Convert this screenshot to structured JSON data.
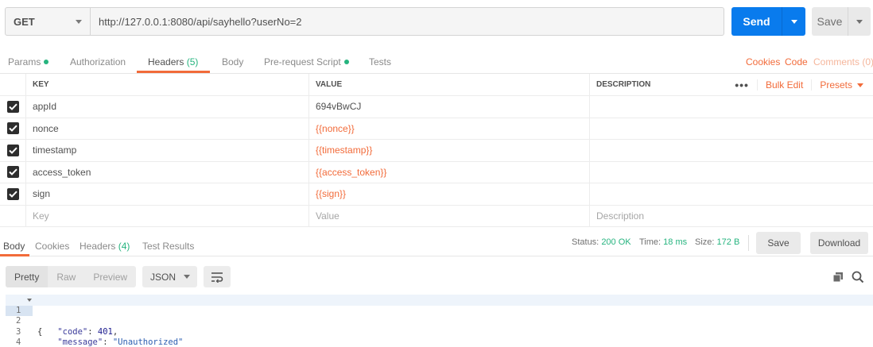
{
  "request": {
    "method": "GET",
    "url": "http://127.0.0.1:8080/api/sayhello?userNo=2",
    "send_label": "Send",
    "save_label": "Save"
  },
  "request_tabs": {
    "params": "Params",
    "authorization": "Authorization",
    "headers": "Headers",
    "headers_count": "(5)",
    "body": "Body",
    "prerequest": "Pre-request Script",
    "tests": "Tests",
    "cookies": "Cookies",
    "code": "Code",
    "comments": "Comments (0)"
  },
  "headers_table": {
    "columns": {
      "key": "KEY",
      "value": "VALUE",
      "description": "DESCRIPTION"
    },
    "more": "•••",
    "bulk_edit": "Bulk Edit",
    "presets": "Presets",
    "rows": [
      {
        "key": "appId",
        "value": "694vBwCJ",
        "checked": true
      },
      {
        "key": "nonce",
        "value": "{{nonce}}",
        "checked": true
      },
      {
        "key": "timestamp",
        "value": "{{timestamp}}",
        "checked": true
      },
      {
        "key": "access_token",
        "value": "{{access_token}}",
        "checked": true
      },
      {
        "key": "sign",
        "value": "{{sign}}",
        "checked": true
      }
    ],
    "placeholder": {
      "key": "Key",
      "value": "Value",
      "description": "Description"
    }
  },
  "response_tabs": {
    "body": "Body",
    "cookies": "Cookies",
    "headers": "Headers",
    "headers_count": "(4)",
    "test_results": "Test Results"
  },
  "response_meta": {
    "status_label": "Status:",
    "status_value": "200 OK",
    "time_label": "Time:",
    "time_value": "18 ms",
    "size_label": "Size:",
    "size_value": "172 B",
    "save": "Save",
    "download": "Download"
  },
  "response_toolbar": {
    "pretty": "Pretty",
    "raw": "Raw",
    "preview": "Preview",
    "format": "JSON"
  },
  "response_body": {
    "line_numbers": [
      "1",
      "2",
      "3",
      "4"
    ],
    "open_brace": "{",
    "code_key": "\"code\"",
    "code_value": "401",
    "message_key": "\"message\"",
    "message_value": "\"Unauthorized\"",
    "close_brace": "}"
  },
  "colors": {
    "accent": "#f26b3a",
    "send": "#097bed",
    "success": "#26b47f"
  }
}
